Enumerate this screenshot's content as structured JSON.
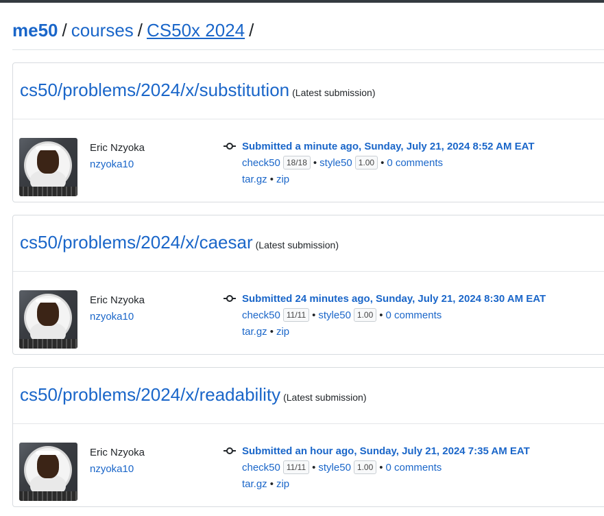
{
  "breadcrumb": {
    "home": "me50",
    "courses": "courses",
    "course": "CS50x 2024",
    "sep": "/"
  },
  "submissions": [
    {
      "slug": "cs50/problems/2024/x/substitution",
      "latest": "(Latest submission)",
      "user_name": "Eric Nzyoka",
      "user_handle": "nzyoka10",
      "submitted": "Submitted a minute ago, Sunday, July 21, 2024 8:52 AM EAT",
      "check50_label": "check50",
      "check50_score": "18/18",
      "style50_label": "style50",
      "style50_score": "1.00",
      "comments": "0 comments",
      "targz": "tar.gz",
      "zip": "zip"
    },
    {
      "slug": "cs50/problems/2024/x/caesar",
      "latest": "(Latest submission)",
      "user_name": "Eric Nzyoka",
      "user_handle": "nzyoka10",
      "submitted": "Submitted 24 minutes ago, Sunday, July 21, 2024 8:30 AM EAT",
      "check50_label": "check50",
      "check50_score": "11/11",
      "style50_label": "style50",
      "style50_score": "1.00",
      "comments": "0 comments",
      "targz": "tar.gz",
      "zip": "zip"
    },
    {
      "slug": "cs50/problems/2024/x/readability",
      "latest": "(Latest submission)",
      "user_name": "Eric Nzyoka",
      "user_handle": "nzyoka10",
      "submitted": "Submitted an hour ago, Sunday, July 21, 2024 7:35 AM EAT",
      "check50_label": "check50",
      "check50_score": "11/11",
      "style50_label": "style50",
      "style50_score": "1.00",
      "comments": "0 comments",
      "targz": "tar.gz",
      "zip": "zip"
    }
  ],
  "bullet": "•",
  "icons": {
    "commit": "git-commit-icon",
    "avatar": "user-avatar"
  },
  "colors": {
    "link": "#1a66c9",
    "text": "#212529",
    "border": "#d7dbdf",
    "topbar": "#343a40"
  }
}
